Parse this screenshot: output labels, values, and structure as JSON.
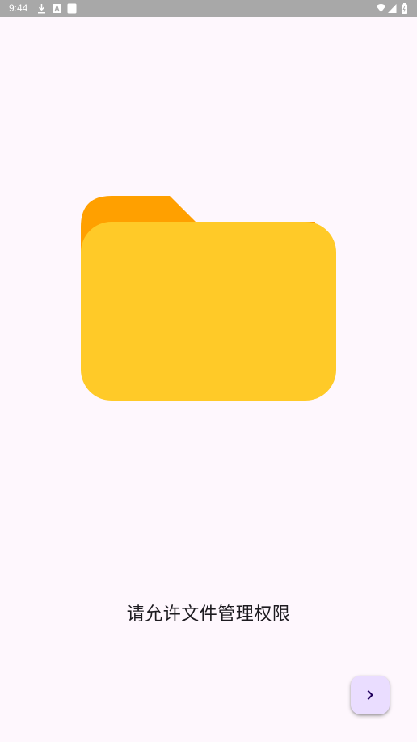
{
  "status_bar": {
    "time": "9:44",
    "icons": [
      "download-icon",
      "a-badge-icon",
      "square-icon",
      "wifi-icon",
      "signal-icon",
      "battery-icon"
    ]
  },
  "main": {
    "illustration_icon": "folder-icon",
    "message": "请允许文件管理权限"
  },
  "next_button": {
    "icon": "chevron-right-icon"
  },
  "colors": {
    "background": "#fef7fd",
    "status_bar": "#a8a8a8",
    "folder_back": "#ffa000",
    "folder_front": "#ffca28",
    "fab_background": "#eaddff",
    "fab_icon": "#21005d",
    "text": "#1d1b20"
  }
}
